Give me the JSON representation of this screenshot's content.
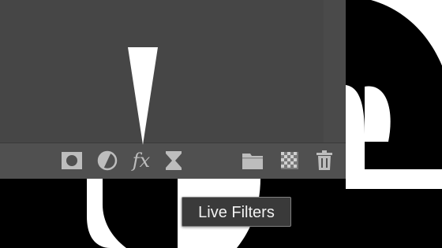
{
  "canvas": {
    "background_color": "#ffffff",
    "text_color": "#000000"
  },
  "panel": {
    "background_color": "#464646",
    "toolbar": {
      "buttons": [
        {
          "name": "mask-icon"
        },
        {
          "name": "adjustment-icon"
        },
        {
          "name": "fx-icon",
          "label": "fx"
        },
        {
          "name": "live-filters-icon"
        },
        {
          "name": "group-folder-icon"
        },
        {
          "name": "pixel-layer-icon"
        },
        {
          "name": "trash-icon"
        }
      ]
    }
  },
  "tooltip": {
    "text": "Live Filters"
  }
}
